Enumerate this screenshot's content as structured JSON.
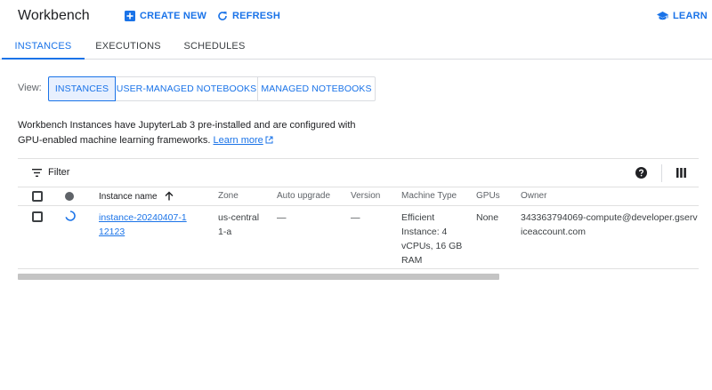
{
  "header": {
    "title": "Workbench",
    "create_label": "CREATE NEW",
    "refresh_label": "REFRESH",
    "learn_label": "LEARN"
  },
  "tabs": [
    {
      "label": "INSTANCES",
      "active": true
    },
    {
      "label": "EXECUTIONS",
      "active": false
    },
    {
      "label": "SCHEDULES",
      "active": false
    }
  ],
  "view": {
    "label": "View:",
    "options": [
      "INSTANCES",
      "USER-MANAGED NOTEBOOKS",
      "MANAGED NOTEBOOKS"
    ],
    "selected": "INSTANCES"
  },
  "description": {
    "text": "Workbench Instances have JupyterLab 3 pre-installed and are configured with GPU-enabled machine learning frameworks.",
    "link": "Learn more"
  },
  "toolbar": {
    "filter_label": "Filter"
  },
  "table": {
    "columns": [
      "Instance name",
      "Zone",
      "Auto upgrade",
      "Version",
      "Machine Type",
      "GPUs",
      "Owner"
    ],
    "sorted_column": "Instance name",
    "rows": [
      {
        "name": "instance-20240407-112123",
        "zone": "us-central1-a",
        "auto_upgrade": "—",
        "version": "—",
        "machine_type": "Efficient Instance: 4 vCPUs, 16 GB RAM",
        "gpus": "None",
        "owner": "343363794069-compute@developer.gserviceaccount.com",
        "status": "loading"
      }
    ]
  },
  "colors": {
    "accent": "#1a73e8",
    "text": "#202124",
    "muted": "#5f6368",
    "border": "#dadce0"
  }
}
